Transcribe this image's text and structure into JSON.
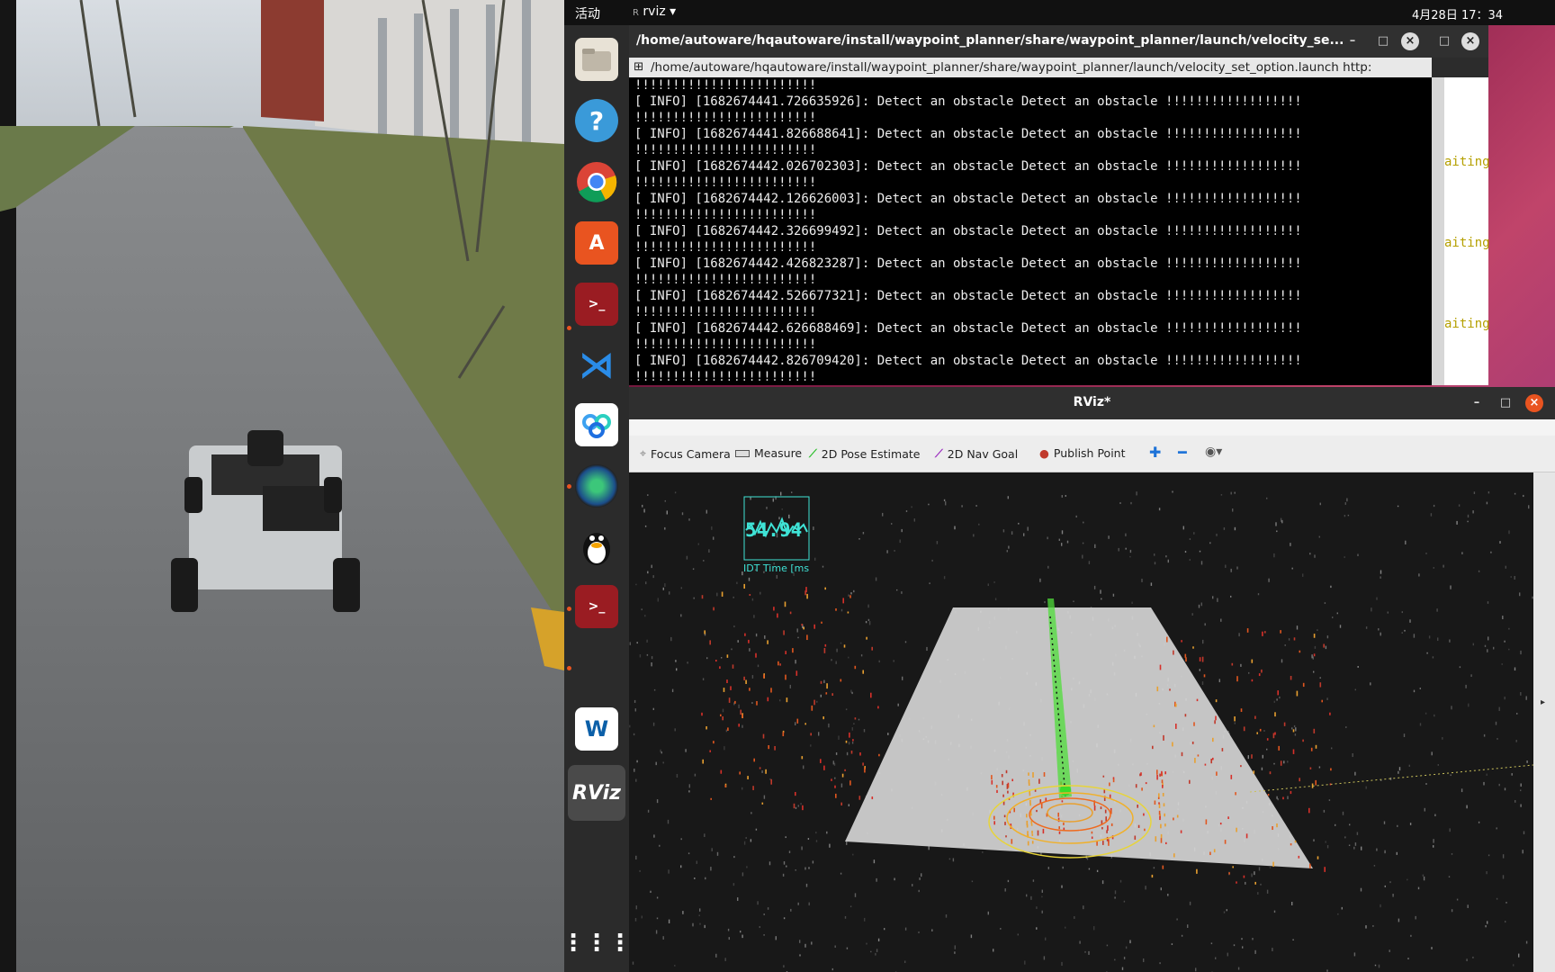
{
  "topbar": {
    "activities": "活动",
    "app_name": "rviz",
    "clock": "4月28日 17：34"
  },
  "dock": {
    "items": [
      {
        "icon": "files-icon"
      },
      {
        "icon": "help-icon"
      },
      {
        "icon": "chrome-icon"
      },
      {
        "icon": "software-center-icon"
      },
      {
        "icon": "terminal-icon"
      },
      {
        "icon": "vscode-icon"
      },
      {
        "icon": "baidu-netdisk-icon"
      },
      {
        "icon": "camera-lens-icon"
      },
      {
        "icon": "qq-penguin-icon"
      },
      {
        "icon": "terminal-icon"
      },
      {
        "icon": "autoware-icon"
      },
      {
        "icon": "rviz-icon",
        "label": "RViz"
      },
      {
        "icon": "show-apps-grid-icon"
      }
    ]
  },
  "terminal": {
    "title": "/home/autoware/hqautoware/install/waypoint_planner/share/waypoint_planner/launch/velocity_se...",
    "tab_title": "/home/autoware/hqautoware/install/waypoint_planner/share/waypoint_planner/launch/velocity_set_option.launch http:",
    "lines": [
      "!!!!!!!!!!!!!!!!!!!!!!!!",
      "[ INFO] [1682674441.726635926]: Detect an obstacle  Detect an obstacle  !!!!!!!!!!!!!!!!!!",
      "!!!!!!!!!!!!!!!!!!!!!!!!",
      "[ INFO] [1682674441.826688641]: Detect an obstacle  Detect an obstacle  !!!!!!!!!!!!!!!!!!",
      "!!!!!!!!!!!!!!!!!!!!!!!!",
      "[ INFO] [1682674442.026702303]: Detect an obstacle  Detect an obstacle  !!!!!!!!!!!!!!!!!!",
      "!!!!!!!!!!!!!!!!!!!!!!!!",
      "[ INFO] [1682674442.126626003]: Detect an obstacle  Detect an obstacle  !!!!!!!!!!!!!!!!!!",
      "!!!!!!!!!!!!!!!!!!!!!!!!",
      "[ INFO] [1682674442.326699492]: Detect an obstacle  Detect an obstacle  !!!!!!!!!!!!!!!!!!",
      "!!!!!!!!!!!!!!!!!!!!!!!!",
      "[ INFO] [1682674442.426823287]: Detect an obstacle  Detect an obstacle  !!!!!!!!!!!!!!!!!!",
      "!!!!!!!!!!!!!!!!!!!!!!!!",
      "[ INFO] [1682674442.526677321]: Detect an obstacle  Detect an obstacle  !!!!!!!!!!!!!!!!!!",
      "!!!!!!!!!!!!!!!!!!!!!!!!",
      "[ INFO] [1682674442.626688469]: Detect an obstacle  Detect an obstacle  !!!!!!!!!!!!!!!!!!",
      "!!!!!!!!!!!!!!!!!!!!!!!!",
      "[ INFO] [1682674442.826709420]: Detect an obstacle  Detect an obstacle  !!!!!!!!!!!!!!!!!!",
      "!!!!!!!!!!!!!!!!!!!!!!!!"
    ],
    "side_text": [
      "aiting",
      "aiting",
      "aiting"
    ]
  },
  "rviz": {
    "title": "RViz*",
    "tools": [
      {
        "label": "Focus Camera",
        "icon": "focus-camera-icon"
      },
      {
        "label": "Measure",
        "icon": "ruler-icon"
      },
      {
        "label": "2D Pose Estimate",
        "icon": "green-arrow-icon"
      },
      {
        "label": "2D Nav Goal",
        "icon": "purple-arrow-icon"
      },
      {
        "label": "Publish Point",
        "icon": "map-pin-icon"
      }
    ],
    "overlay": {
      "value": "54.94",
      "label": "IDT Time [ms"
    }
  },
  "colors": {
    "ubuntu_orange": "#e95420",
    "overlay_cyan": "#3fe3d6",
    "path_green": "#4fdc3a"
  }
}
